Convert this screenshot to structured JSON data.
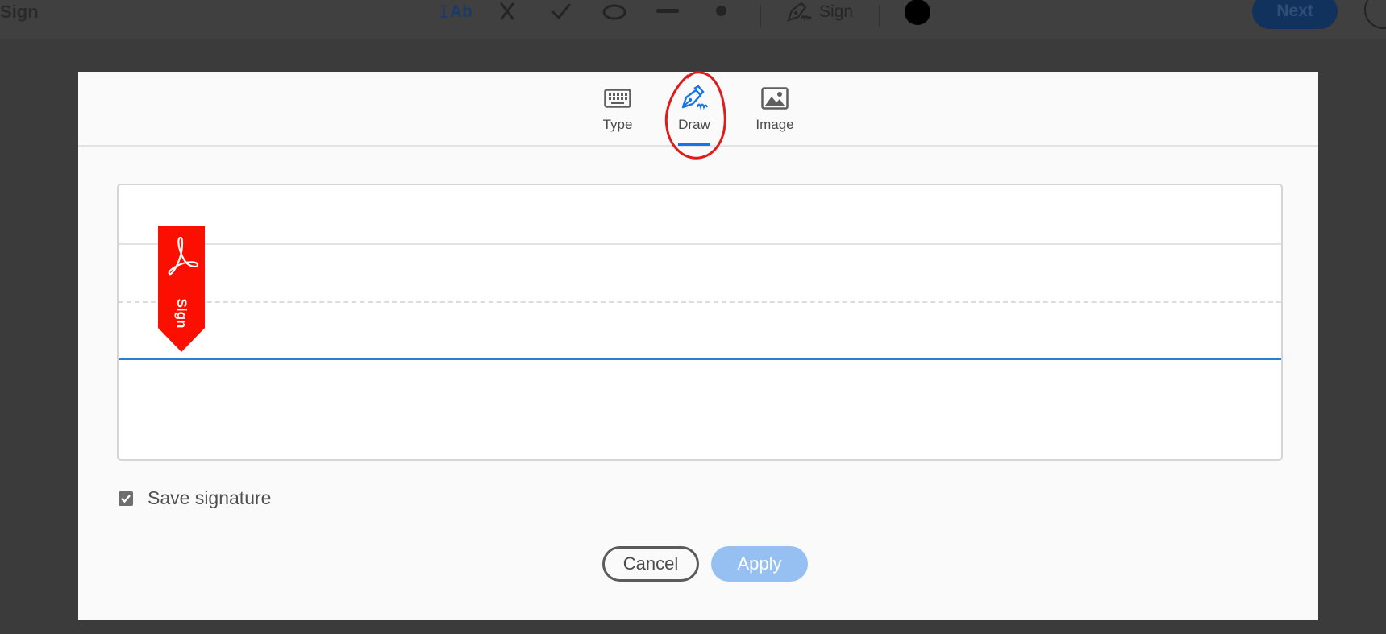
{
  "toolbar": {
    "title": "Sign",
    "text_tool_label": "Ab",
    "sign_label": "Sign",
    "next_label": "Next",
    "tools": [
      "text-tool",
      "cross-tool",
      "check-tool",
      "ellipse-tool",
      "line-tool",
      "dot-tool"
    ]
  },
  "dialog": {
    "tabs": [
      {
        "label": "Type",
        "icon": "keyboard-icon",
        "active": false
      },
      {
        "label": "Draw",
        "icon": "pen-icon",
        "active": true
      },
      {
        "label": "Image",
        "icon": "image-icon",
        "active": false
      }
    ],
    "sign_flag_label": "Sign",
    "save_signature": {
      "label": "Save signature",
      "checked": true
    },
    "cancel_label": "Cancel",
    "apply_label": "Apply"
  },
  "colors": {
    "accent": "#1473e6",
    "apply_disabled": "#96c0f2",
    "flag_red": "#fa0f00",
    "annotation_red": "#e01b1b"
  }
}
